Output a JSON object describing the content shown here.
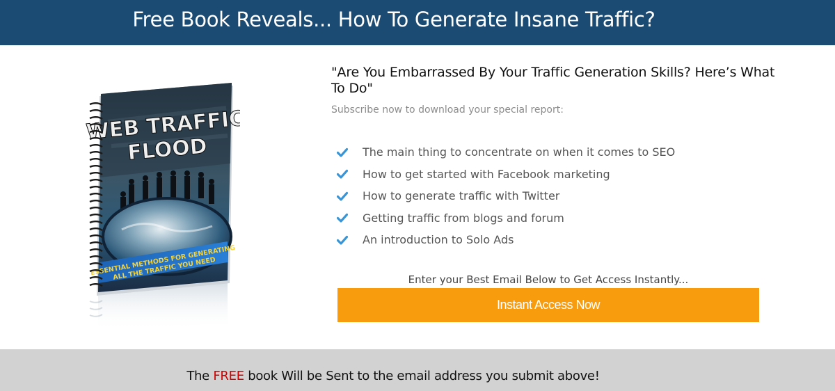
{
  "header": {
    "title": "Free Book Reveals... How To Generate Insane Traffic?"
  },
  "book": {
    "title_line1": "WEB TRAFFIC",
    "title_line2": "FLOOD",
    "tagline_line1": "ESSENTIAL METHODS FOR GENERATING",
    "tagline_line2": "ALL THE TRAFFIC YOU NEED"
  },
  "main": {
    "headline": "\"Are You Embarrassed By Your Traffic Generation Skills? Here’s What To Do\"",
    "subtitle": "Subscribe now to download your special report:",
    "benefits": [
      {
        "text": "The main thing to concentrate on when it comes to SEO",
        "icon": "check-icon"
      },
      {
        "text": "How to get started with Facebook marketing",
        "icon": "check-icon"
      },
      {
        "text": "How to generate traffic with Twitter",
        "icon": "check-icon"
      },
      {
        "text": "Getting traffic from blogs and forum",
        "icon": "check-icon"
      },
      {
        "text": "An introduction to Solo Ads",
        "icon": "check-icon"
      }
    ],
    "email_prompt": "Enter your Best Email Below to Get Access Instantly...",
    "cta_label": "Instant Access Now"
  },
  "footer": {
    "prefix": "The",
    "highlight": "FREE",
    "suffix": "book Will be Sent to the email address you submit above!"
  },
  "colors": {
    "header_bg": "#1b4a73",
    "cta_bg": "#f89c0e",
    "check": "#3a95d6",
    "footer_bg": "#d2d2d2",
    "highlight": "#d40000"
  }
}
